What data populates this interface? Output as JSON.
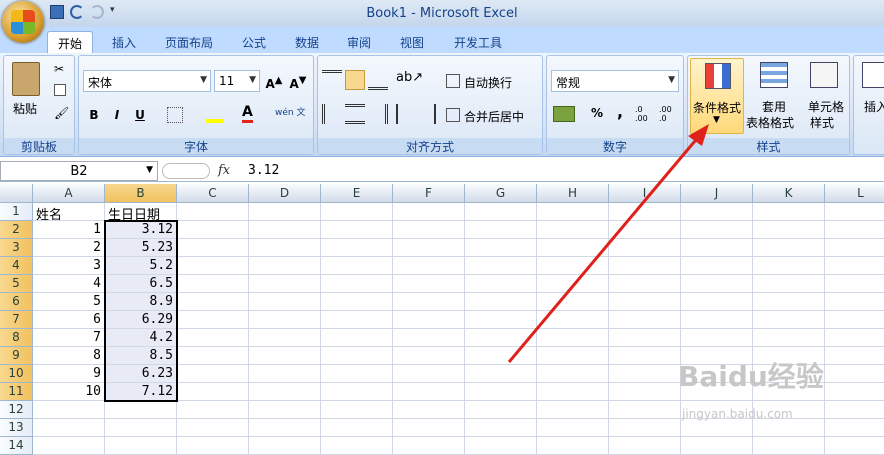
{
  "window": {
    "title": "Book1 - Microsoft Excel"
  },
  "tabs": [
    "开始",
    "插入",
    "页面布局",
    "公式",
    "数据",
    "审阅",
    "视图",
    "开发工具"
  ],
  "ribbon": {
    "clipboard": {
      "paste": "粘贴",
      "group": "剪贴板"
    },
    "font": {
      "name": "宋体",
      "size": "11",
      "bold": "B",
      "italic": "I",
      "underline": "U",
      "group": "字体",
      "wen": "wén 文"
    },
    "alignment": {
      "wrap": "自动换行",
      "merge": "合并后居中",
      "group": "对齐方式"
    },
    "number": {
      "format": "常规",
      "percent": "%",
      "comma": ",",
      "inc": ".0 .00",
      "dec": ".00 .0",
      "group": "数字"
    },
    "styles": {
      "conditional": "条件格式",
      "table1": "套用",
      "table2": "表格格式",
      "cell1": "单元格",
      "cell2": "样式",
      "group": "样式"
    },
    "cells": {
      "insert": "插入"
    }
  },
  "formula": {
    "namebox": "B2",
    "fx": "fx",
    "value": "3.12"
  },
  "columns": [
    "A",
    "B",
    "C",
    "D",
    "E",
    "F",
    "G",
    "H",
    "I",
    "J",
    "K",
    "L"
  ],
  "rows": [
    "1",
    "2",
    "3",
    "4",
    "5",
    "6",
    "7",
    "8",
    "9",
    "10",
    "11",
    "12",
    "13",
    "14"
  ],
  "sheet": {
    "headers": {
      "a1": "姓名",
      "b1": "生日日期"
    },
    "a": [
      "1",
      "2",
      "3",
      "4",
      "5",
      "6",
      "7",
      "8",
      "9",
      "10"
    ],
    "b": [
      "3.12",
      "5.23",
      "5.2",
      "6.5",
      "8.9",
      "6.29",
      "4.2",
      "8.5",
      "6.23",
      "7.12"
    ]
  },
  "watermark": {
    "brand": "Baidu经验",
    "url": "jingyan.baidu.com"
  },
  "colors": {
    "arrow": "#e0201b",
    "accent": "#f1c15f"
  }
}
